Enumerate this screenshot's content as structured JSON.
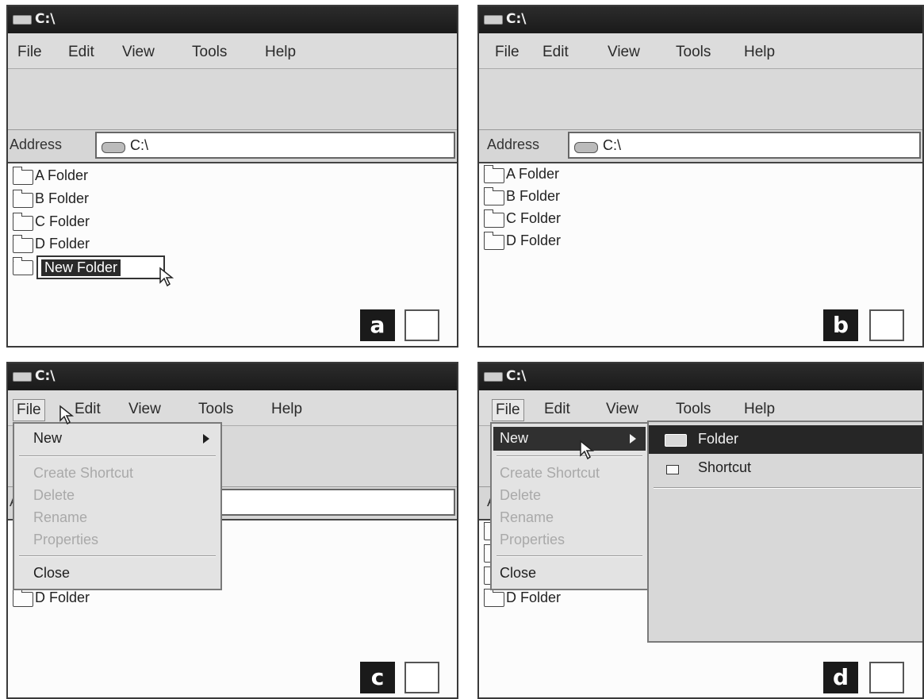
{
  "window": {
    "title": "C:\\"
  },
  "menu": [
    "File",
    "Edit",
    "View",
    "Tools",
    "Help"
  ],
  "address": {
    "label": "Address",
    "value": "C:\\"
  },
  "folders": [
    "A Folder",
    "B Folder",
    "C Folder",
    "D Folder"
  ],
  "rename": {
    "value": "New Folder"
  },
  "panels": {
    "a": {
      "letter": "a"
    },
    "b": {
      "letter": "b"
    },
    "c": {
      "letter": "c"
    },
    "d": {
      "letter": "d"
    }
  },
  "file_menu": {
    "new": "New",
    "create_shortcut": "Create Shortcut",
    "delete": "Delete",
    "rename": "Rename",
    "properties": "Properties",
    "close": "Close"
  },
  "new_submenu": {
    "folder": "Folder",
    "shortcut": "Shortcut"
  },
  "icons": {
    "title": "drive-icon",
    "address": "drive-icon",
    "folder": "folder-icon",
    "shortcut": "shortcut-icon",
    "cursor": "mouse-pointer-icon",
    "submenu_arrow": "triangle-right-icon"
  },
  "colors": {
    "title_bar": "#1a1a1a",
    "menu_bg": "#dcdcdc",
    "highlight": "#2a2a2a",
    "disabled_text": "#a9a9a9"
  }
}
